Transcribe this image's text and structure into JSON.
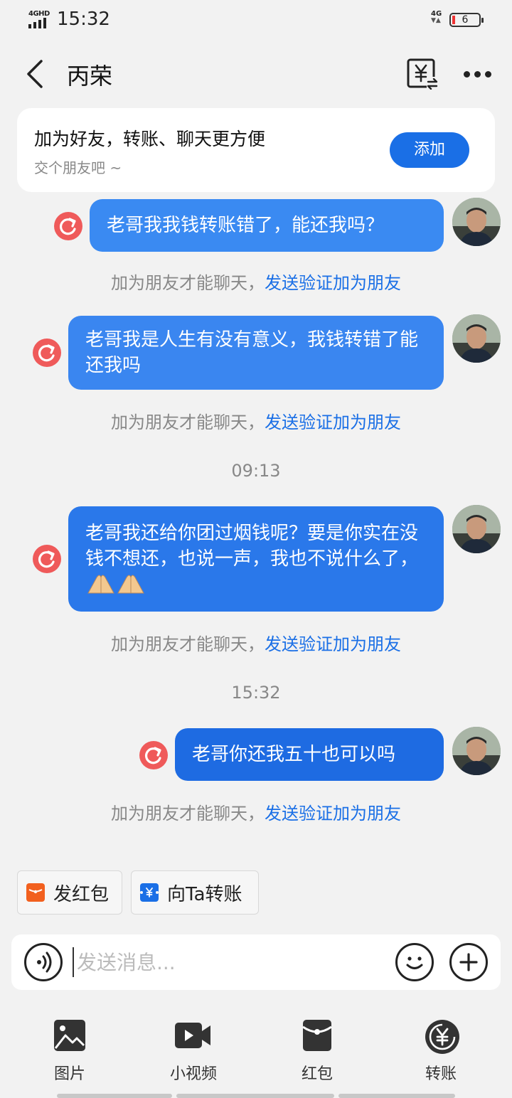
{
  "status_bar": {
    "network": "4GHD",
    "time": "15:32",
    "network_right": "4G",
    "battery": "6"
  },
  "header": {
    "title": "丙荣"
  },
  "add_friend": {
    "title": "加为好友，转账、聊天更方便",
    "subtitle": "交个朋友吧 ~",
    "button": "添加"
  },
  "messages": [
    {
      "text": "老哥我我钱转账错了，能还我吗？"
    },
    {
      "text": "老哥我是人生有没有意义，我钱转错了能还我吗"
    },
    {
      "text": "老哥我还给你团过烟钱呢？要是你实在没钱不想还，也说一声，我也不说什么了，"
    },
    {
      "text": "老哥你还我五十也可以吗"
    }
  ],
  "timestamps": [
    "09:13",
    "15:32"
  ],
  "hint": {
    "prefix": "加为朋友才能聊天，",
    "link": "发送验证加为朋友"
  },
  "quick_actions": [
    {
      "label": "发红包",
      "icon": "red-packet-icon",
      "color": "#f2601e"
    },
    {
      "label": "向Ta转账",
      "icon": "transfer-icon",
      "color": "#1a6fe6"
    }
  ],
  "input": {
    "placeholder": "发送消息..."
  },
  "toolbar": [
    {
      "label": "图片",
      "icon": "image-icon"
    },
    {
      "label": "小视频",
      "icon": "video-icon"
    },
    {
      "label": "红包",
      "icon": "red-packet-icon"
    },
    {
      "label": "转账",
      "icon": "transfer-icon"
    }
  ],
  "colors": {
    "accent": "#1a6fe6",
    "bubble_light": "#3b8cf3",
    "bubble_dark": "#1f6ee3",
    "retry": "#ef5a5a"
  }
}
